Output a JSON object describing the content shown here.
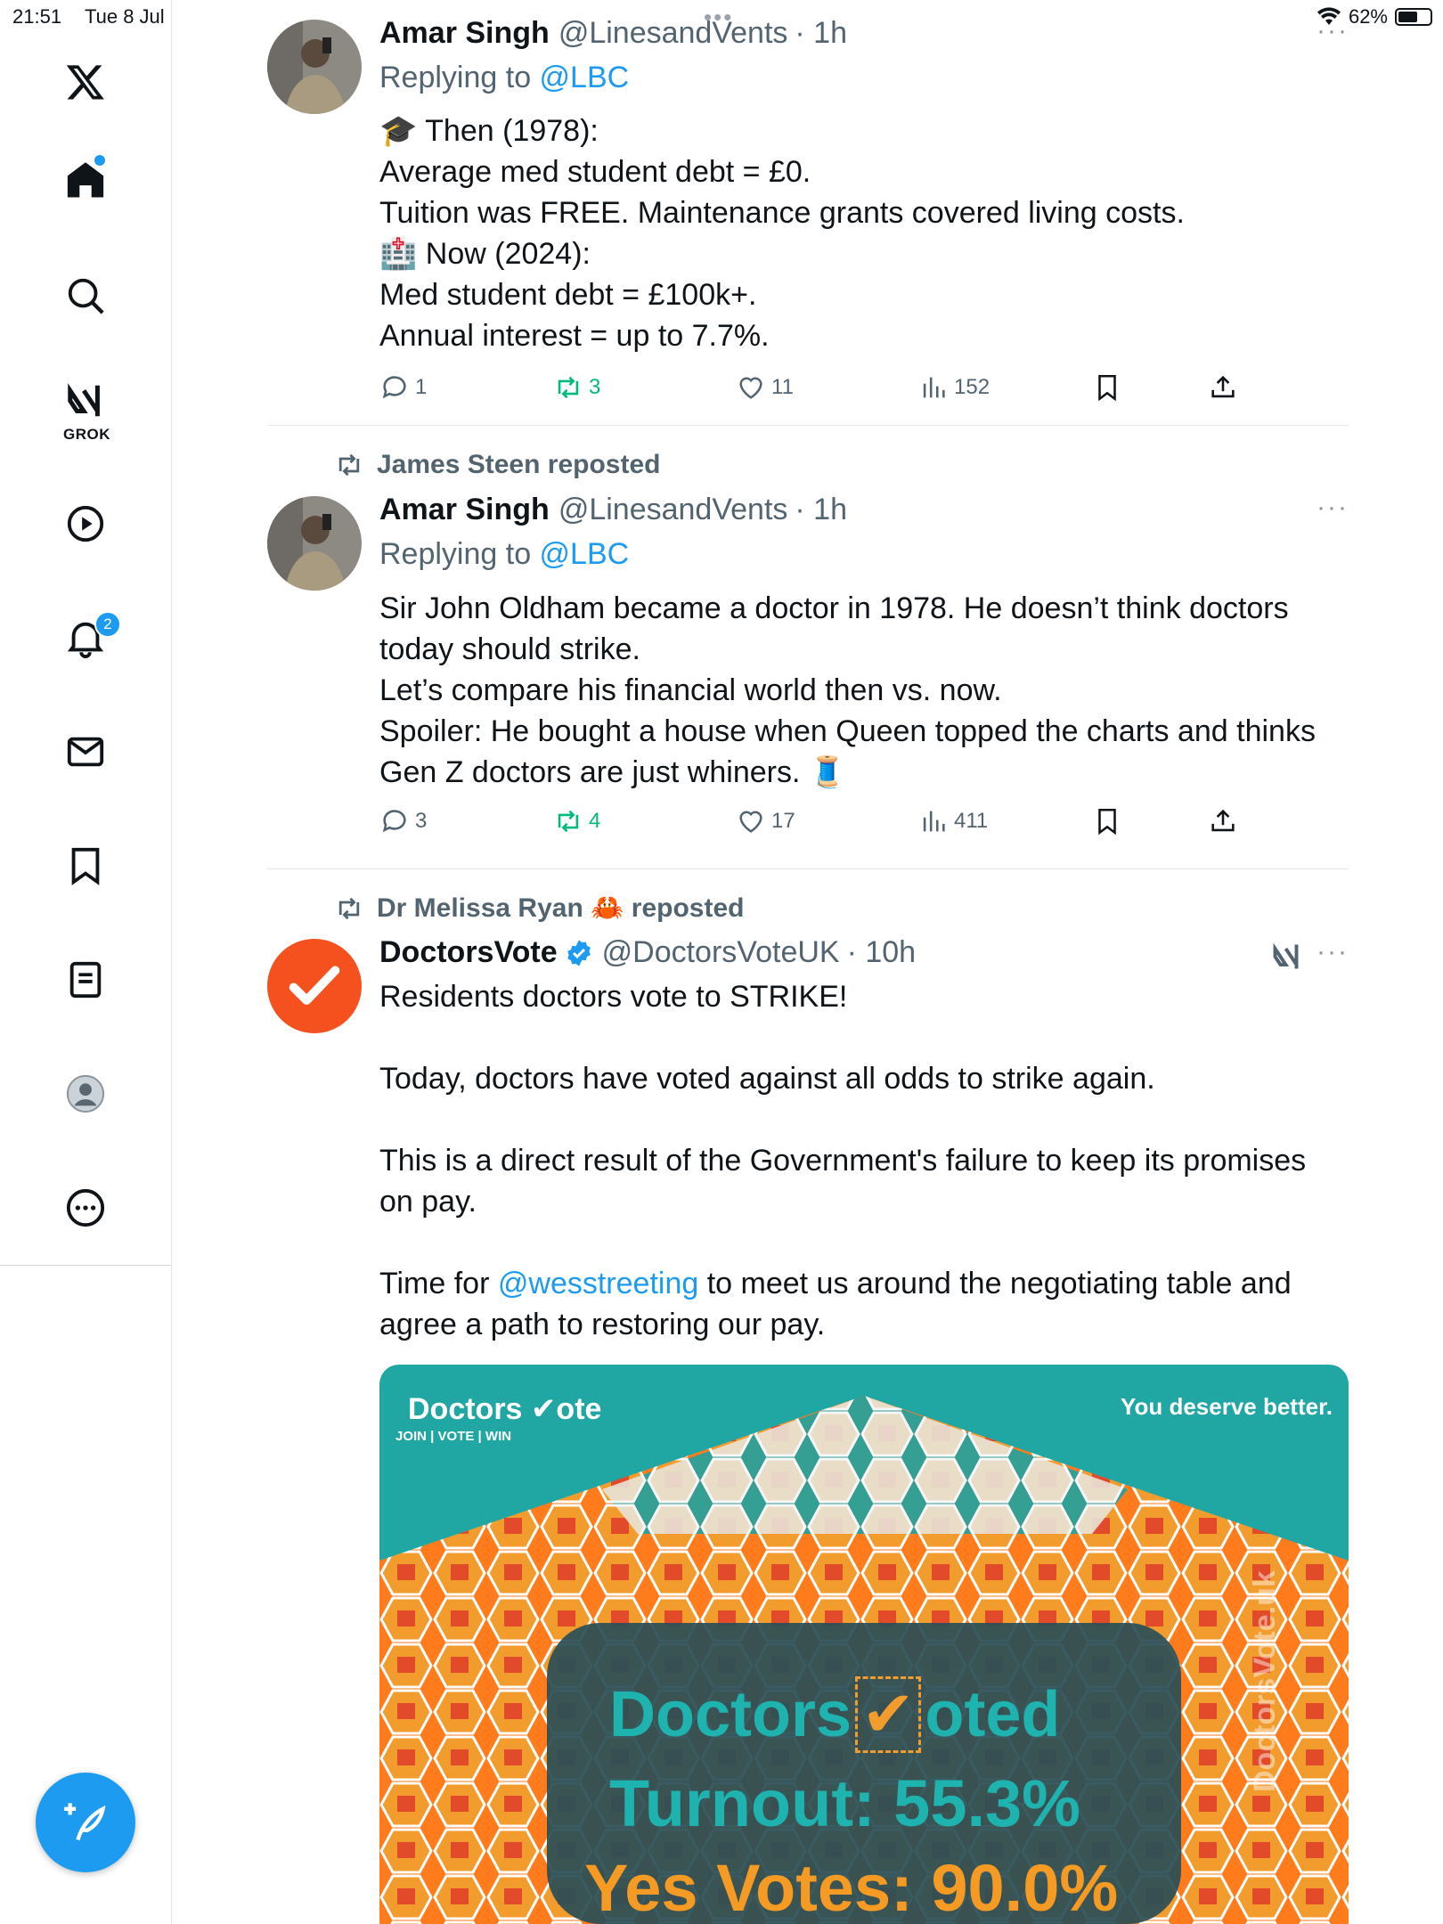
{
  "status_bar": {
    "time": "21:51",
    "date": "Tue 8 Jul",
    "battery": "62%",
    "battery_fraction": 0.62
  },
  "sidebar": {
    "items": [
      {
        "icon": "x-logo-icon"
      },
      {
        "icon": "home-icon",
        "has_dot": true
      },
      {
        "icon": "search-icon"
      },
      {
        "icon": "grok-icon",
        "label": "GROK"
      },
      {
        "icon": "video-icon"
      },
      {
        "icon": "bell-icon",
        "badge": "2"
      },
      {
        "icon": "mail-icon"
      },
      {
        "icon": "bookmark-icon"
      },
      {
        "icon": "lists-icon"
      },
      {
        "icon": "profile-icon"
      },
      {
        "icon": "more-icon"
      }
    ],
    "compose_icon": "compose-icon"
  },
  "feed": {
    "tweets": [
      {
        "name": "Amar Singh",
        "handle": "@LinesandVents",
        "time": "· 1h",
        "replying_label": "Replying to ",
        "replying_to": "@LBC",
        "lines": [
          "🎓 Then (1978):",
          "Average med student debt = £0.",
          "Tuition was FREE. Maintenance grants covered living costs.",
          "🏥 Now (2024):",
          "Med student debt = £100k+.",
          "Annual interest = up to 7.7%."
        ],
        "stats": {
          "replies": "1",
          "reposts": "3",
          "likes": "11",
          "views": "152"
        }
      },
      {
        "reposted_by": "James Steen reposted",
        "name": "Amar Singh",
        "handle": "@LinesandVents",
        "time": "· 1h",
        "replying_label": "Replying to ",
        "replying_to": "@LBC",
        "lines": [
          "Sir John Oldham became a doctor in 1978. He doesn’t think doctors today should strike.",
          "Let’s compare his financial world then vs. now.",
          "Spoiler: He bought a house when Queen topped the charts and thinks Gen Z doctors are just whiners. 🧵"
        ],
        "stats": {
          "replies": "3",
          "reposts": "4",
          "likes": "17",
          "views": "411"
        }
      },
      {
        "reposted_by": "Dr Melissa Ryan 🦀 reposted",
        "name": "DoctorsVote",
        "handle": "@DoctorsVoteUK",
        "time": "· 10h",
        "lines": [
          "Residents doctors vote to STRIKE!",
          "",
          "Today, doctors have voted against all odds to strike again.",
          "",
          "This is a direct result of the Government's failure to keep its promises on pay.",
          ""
        ],
        "last_pre": "Time for ",
        "mention": "@wesstreeting",
        "last_post": " to meet us around the negotiating table and agree a path to restoring our pay.",
        "media": {
          "logo_a": "Doctors",
          "logo_b": "ote",
          "logo_sub": "JOIN | VOTE | WIN",
          "tagline": "You deserve better.",
          "headline_a": "Doctors",
          "headline_b": "oted",
          "turnout": "Turnout: 55.3%",
          "yes_votes": "Yes Votes: 90.0%",
          "watermark": "DoctorsVote.uk"
        }
      }
    ]
  }
}
